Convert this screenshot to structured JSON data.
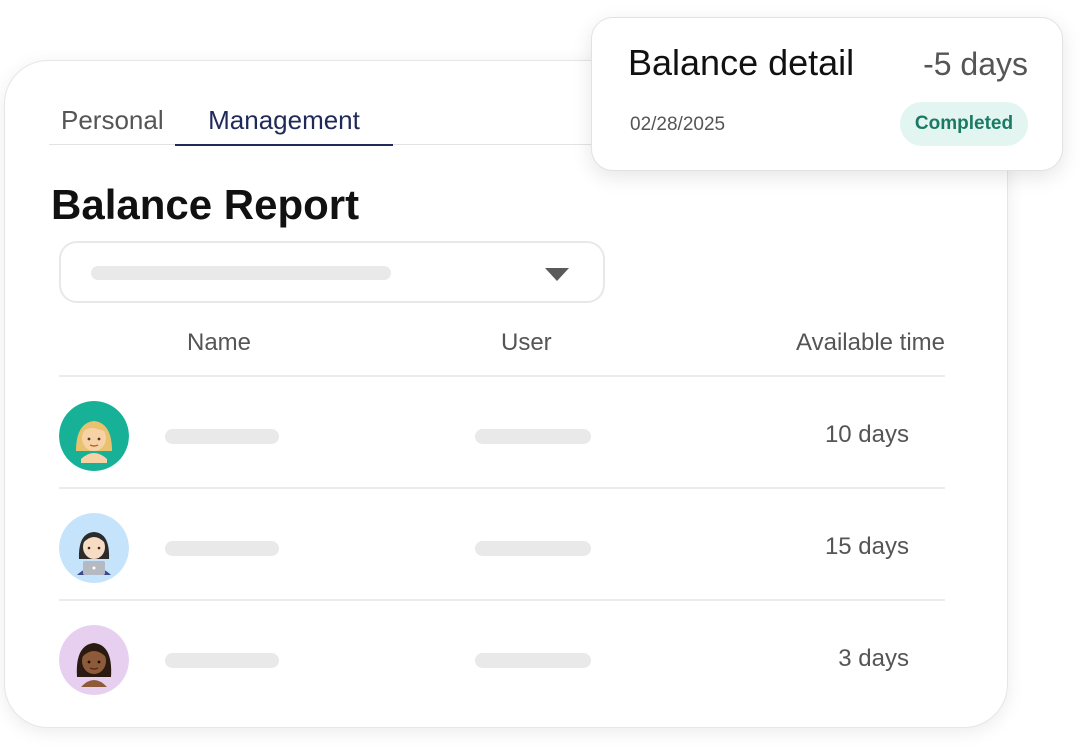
{
  "tabs": {
    "personal": "Personal",
    "management": "Management"
  },
  "report": {
    "title": "Balance Report"
  },
  "table": {
    "headers": {
      "name": "Name",
      "user": "User",
      "available": "Available time"
    },
    "rows": [
      {
        "avatar_color": "#16b197",
        "available": "10 days"
      },
      {
        "avatar_color": "#c5e3fb",
        "available": "15 days"
      },
      {
        "avatar_color": "#e7cff0",
        "available": "3 days"
      }
    ]
  },
  "detail": {
    "title": "Balance detail",
    "value": "-5 days",
    "date": "02/28/2025",
    "status": "Completed"
  },
  "colors": {
    "accent": "#1f2a5a",
    "status_bg": "#e3f5f1",
    "status_text": "#1a7a66"
  }
}
